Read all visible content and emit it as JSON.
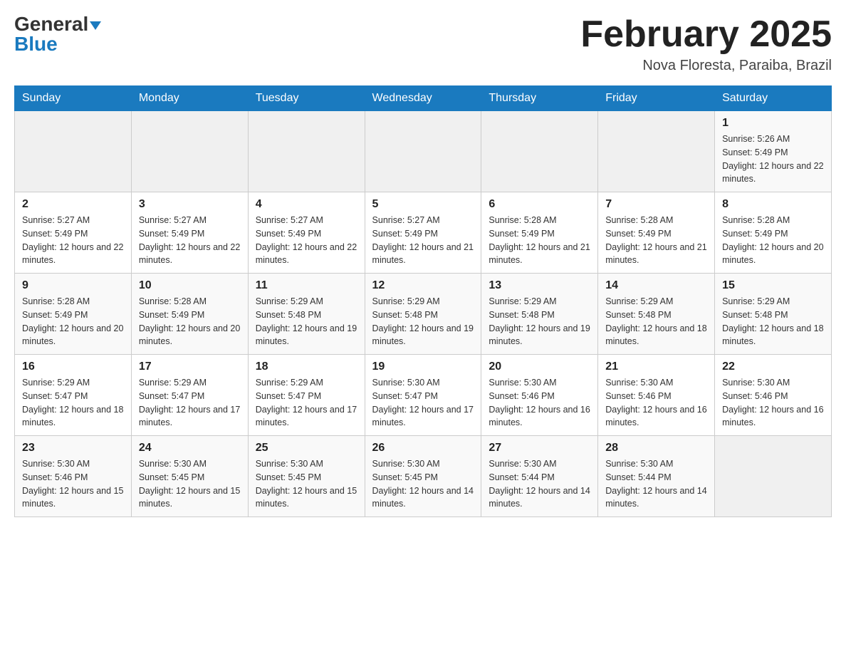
{
  "header": {
    "logo_general": "General",
    "logo_blue": "Blue",
    "month_title": "February 2025",
    "location": "Nova Floresta, Paraiba, Brazil"
  },
  "days_of_week": [
    "Sunday",
    "Monday",
    "Tuesday",
    "Wednesday",
    "Thursday",
    "Friday",
    "Saturday"
  ],
  "weeks": [
    [
      {
        "day": "",
        "info": ""
      },
      {
        "day": "",
        "info": ""
      },
      {
        "day": "",
        "info": ""
      },
      {
        "day": "",
        "info": ""
      },
      {
        "day": "",
        "info": ""
      },
      {
        "day": "",
        "info": ""
      },
      {
        "day": "1",
        "info": "Sunrise: 5:26 AM\nSunset: 5:49 PM\nDaylight: 12 hours and 22 minutes."
      }
    ],
    [
      {
        "day": "2",
        "info": "Sunrise: 5:27 AM\nSunset: 5:49 PM\nDaylight: 12 hours and 22 minutes."
      },
      {
        "day": "3",
        "info": "Sunrise: 5:27 AM\nSunset: 5:49 PM\nDaylight: 12 hours and 22 minutes."
      },
      {
        "day": "4",
        "info": "Sunrise: 5:27 AM\nSunset: 5:49 PM\nDaylight: 12 hours and 22 minutes."
      },
      {
        "day": "5",
        "info": "Sunrise: 5:27 AM\nSunset: 5:49 PM\nDaylight: 12 hours and 21 minutes."
      },
      {
        "day": "6",
        "info": "Sunrise: 5:28 AM\nSunset: 5:49 PM\nDaylight: 12 hours and 21 minutes."
      },
      {
        "day": "7",
        "info": "Sunrise: 5:28 AM\nSunset: 5:49 PM\nDaylight: 12 hours and 21 minutes."
      },
      {
        "day": "8",
        "info": "Sunrise: 5:28 AM\nSunset: 5:49 PM\nDaylight: 12 hours and 20 minutes."
      }
    ],
    [
      {
        "day": "9",
        "info": "Sunrise: 5:28 AM\nSunset: 5:49 PM\nDaylight: 12 hours and 20 minutes."
      },
      {
        "day": "10",
        "info": "Sunrise: 5:28 AM\nSunset: 5:49 PM\nDaylight: 12 hours and 20 minutes."
      },
      {
        "day": "11",
        "info": "Sunrise: 5:29 AM\nSunset: 5:48 PM\nDaylight: 12 hours and 19 minutes."
      },
      {
        "day": "12",
        "info": "Sunrise: 5:29 AM\nSunset: 5:48 PM\nDaylight: 12 hours and 19 minutes."
      },
      {
        "day": "13",
        "info": "Sunrise: 5:29 AM\nSunset: 5:48 PM\nDaylight: 12 hours and 19 minutes."
      },
      {
        "day": "14",
        "info": "Sunrise: 5:29 AM\nSunset: 5:48 PM\nDaylight: 12 hours and 18 minutes."
      },
      {
        "day": "15",
        "info": "Sunrise: 5:29 AM\nSunset: 5:48 PM\nDaylight: 12 hours and 18 minutes."
      }
    ],
    [
      {
        "day": "16",
        "info": "Sunrise: 5:29 AM\nSunset: 5:47 PM\nDaylight: 12 hours and 18 minutes."
      },
      {
        "day": "17",
        "info": "Sunrise: 5:29 AM\nSunset: 5:47 PM\nDaylight: 12 hours and 17 minutes."
      },
      {
        "day": "18",
        "info": "Sunrise: 5:29 AM\nSunset: 5:47 PM\nDaylight: 12 hours and 17 minutes."
      },
      {
        "day": "19",
        "info": "Sunrise: 5:30 AM\nSunset: 5:47 PM\nDaylight: 12 hours and 17 minutes."
      },
      {
        "day": "20",
        "info": "Sunrise: 5:30 AM\nSunset: 5:46 PM\nDaylight: 12 hours and 16 minutes."
      },
      {
        "day": "21",
        "info": "Sunrise: 5:30 AM\nSunset: 5:46 PM\nDaylight: 12 hours and 16 minutes."
      },
      {
        "day": "22",
        "info": "Sunrise: 5:30 AM\nSunset: 5:46 PM\nDaylight: 12 hours and 16 minutes."
      }
    ],
    [
      {
        "day": "23",
        "info": "Sunrise: 5:30 AM\nSunset: 5:46 PM\nDaylight: 12 hours and 15 minutes."
      },
      {
        "day": "24",
        "info": "Sunrise: 5:30 AM\nSunset: 5:45 PM\nDaylight: 12 hours and 15 minutes."
      },
      {
        "day": "25",
        "info": "Sunrise: 5:30 AM\nSunset: 5:45 PM\nDaylight: 12 hours and 15 minutes."
      },
      {
        "day": "26",
        "info": "Sunrise: 5:30 AM\nSunset: 5:45 PM\nDaylight: 12 hours and 14 minutes."
      },
      {
        "day": "27",
        "info": "Sunrise: 5:30 AM\nSunset: 5:44 PM\nDaylight: 12 hours and 14 minutes."
      },
      {
        "day": "28",
        "info": "Sunrise: 5:30 AM\nSunset: 5:44 PM\nDaylight: 12 hours and 14 minutes."
      },
      {
        "day": "",
        "info": ""
      }
    ]
  ]
}
